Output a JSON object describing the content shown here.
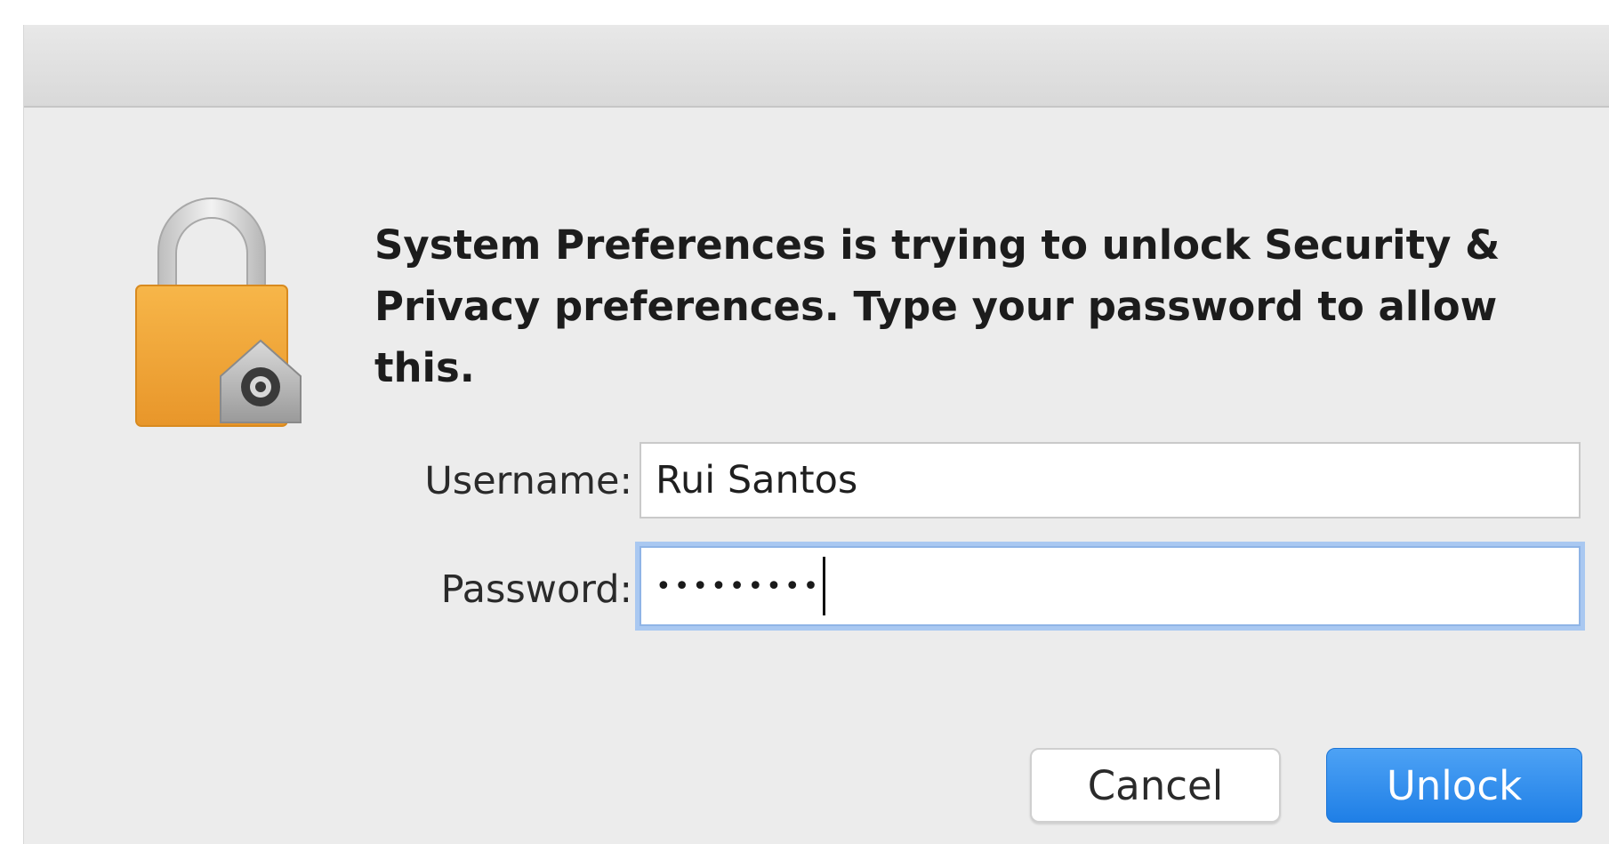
{
  "dialog": {
    "message": "System Preferences is trying to unlock Security & Privacy preferences. Type your password to allow this.",
    "icon": "lock-icon"
  },
  "form": {
    "username_label": "Username:",
    "username_value": "Rui Santos",
    "password_label": "Password:",
    "password_value": "•••••••••"
  },
  "buttons": {
    "cancel_label": "Cancel",
    "unlock_label": "Unlock"
  },
  "colors": {
    "lock_body": "#f0a63a",
    "lock_shackle": "#c9c9c9",
    "focus_ring": "#a9c8f1",
    "unlock_button": "#2b88ee"
  }
}
